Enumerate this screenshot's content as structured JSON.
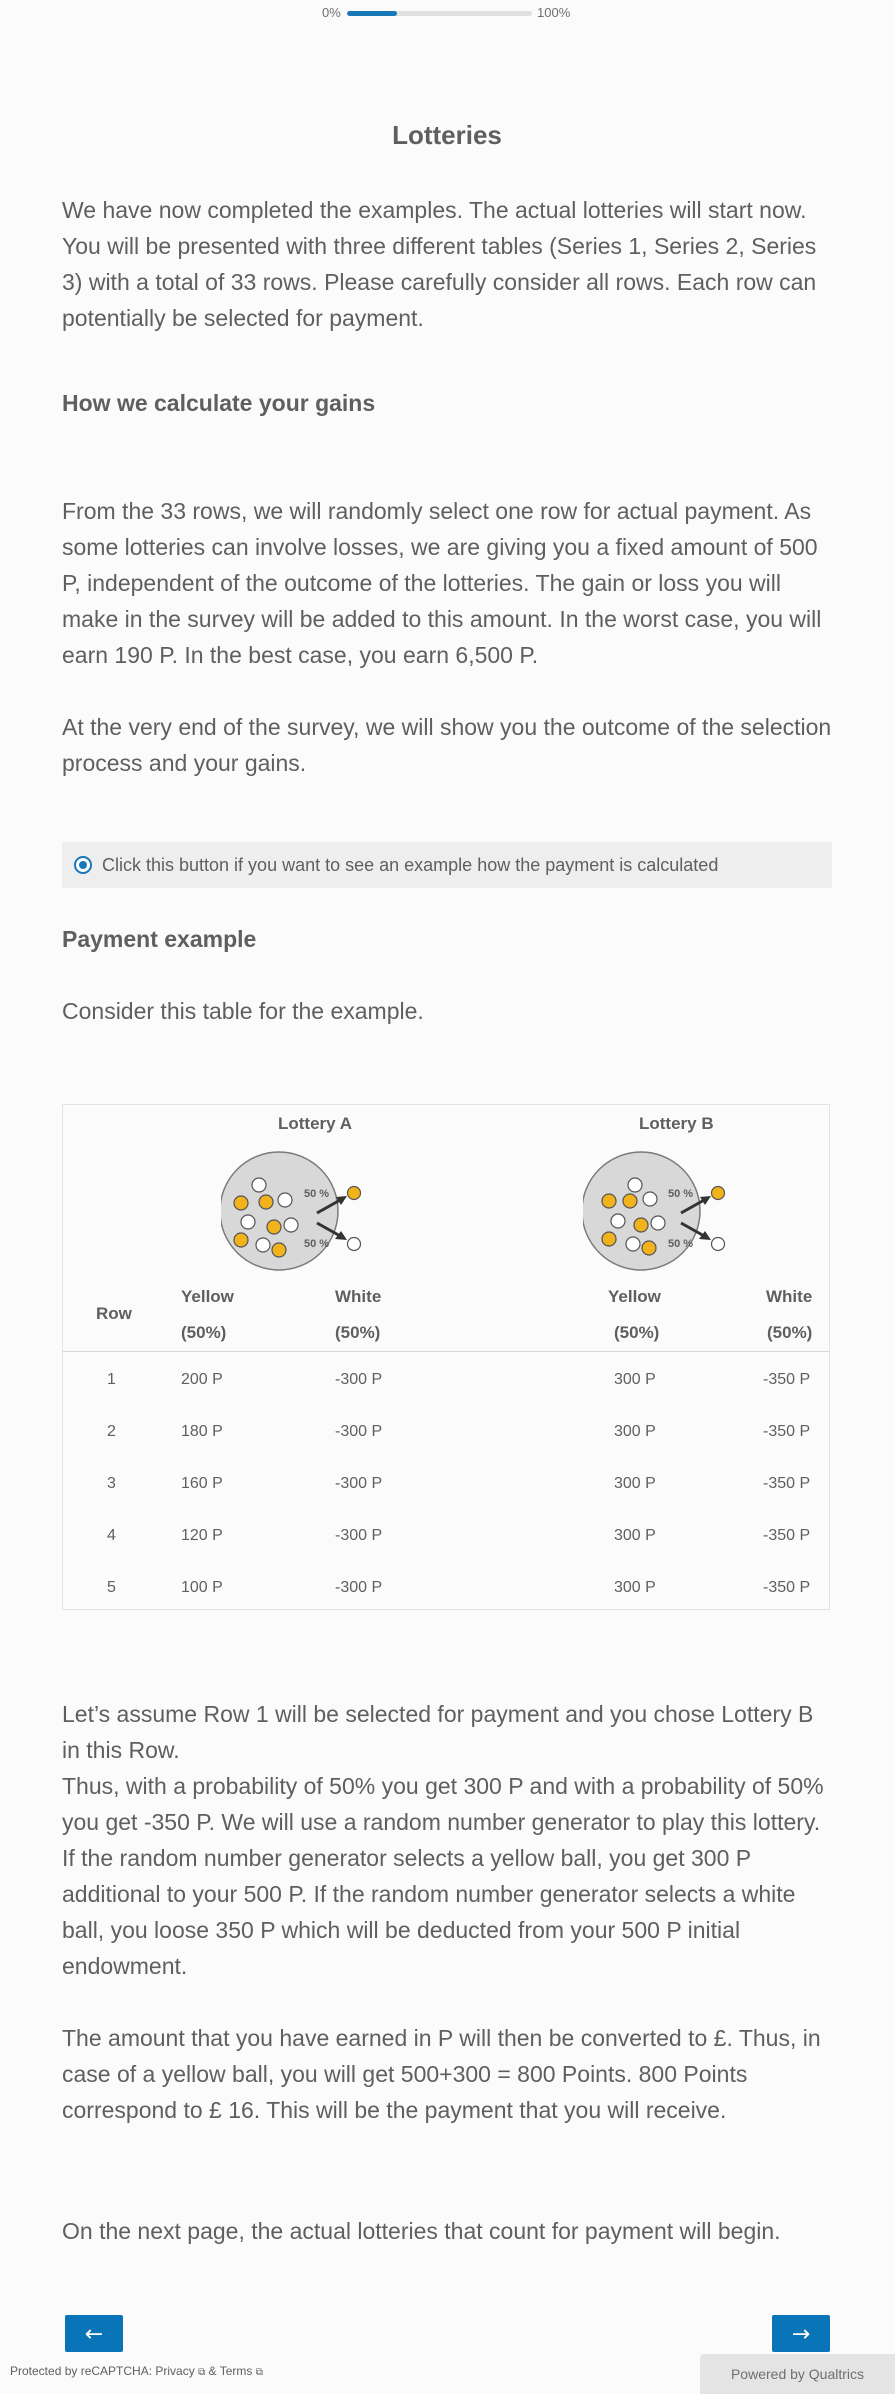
{
  "progress": {
    "left_label": "0%",
    "right_label": "100%",
    "value": 0.27,
    "color": "#1878b8"
  },
  "title": "Lotteries",
  "intro": "We have now completed the examples. The actual lotteries will start now. You will be presented with three different tables (Series 1, Series 2, Series 3) with a total of 33 rows. Please carefully consider all rows. Each row can potentially be selected for payment.",
  "gains_heading": "How we calculate your gains",
  "gains_para1": "From the 33 rows, we will randomly select one row for actual payment. As some lotteries can involve losses, we are giving you a fixed amount of 500 P, independent of the outcome of the lotteries. The gain or loss you will make in the survey will be added to this amount. In the worst case, you will earn 190 P. In the best case, you earn 6,500 P.",
  "gains_para2": "At the very end of the survey, we will show you the outcome of the selection process and your gains.",
  "toggle_label": "Click this button if you want to see an example how the payment is calculated",
  "example_heading": "Payment example",
  "example_intro": "Consider this table for the example.",
  "table": {
    "lottery_a": "Lottery A",
    "lottery_b": "Lottery B",
    "pct_label": "50 %",
    "row_header": "Row",
    "yellow": "Yellow",
    "white": "White",
    "pct_sub": "(50%)",
    "rows": [
      {
        "row": "1",
        "a_yellow": "200 P",
        "a_white": "-300 P",
        "b_yellow": "300 P",
        "b_white": "-350 P"
      },
      {
        "row": "2",
        "a_yellow": "180 P",
        "a_white": "-300 P",
        "b_yellow": "300 P",
        "b_white": "-350 P"
      },
      {
        "row": "3",
        "a_yellow": "160 P",
        "a_white": "-300 P",
        "b_yellow": "300 P",
        "b_white": "-350 P"
      },
      {
        "row": "4",
        "a_yellow": "120 P",
        "a_white": "-300 P",
        "b_yellow": "300 P",
        "b_white": "-350 P"
      },
      {
        "row": "5",
        "a_yellow": "100 P",
        "a_white": "-300 P",
        "b_yellow": "300 P",
        "b_white": "-350 P"
      }
    ],
    "colors": {
      "yellow_ball": "#f2b21b",
      "white_ball": "#ffffff",
      "urn": "#d8d8d8"
    }
  },
  "explain_para1": "Let’s assume Row 1 will be selected for payment and you chose Lottery B in this Row.",
  "explain_para2": "Thus, with a probability of 50% you get 300 P and with a probability of 50% you get -350 P. We will use a random number generator to play this lottery. If the random number generator selects a yellow ball, you get 300 P additional to your 500 P. If the random number generator selects a white ball, you loose 350 P which will be deducted from your 500 P initial endowment.",
  "explain_para3": "The amount that you have earned in P will then be converted to £. Thus, in case of a yellow ball, you will get 500+300 = 800 Points. 800 Points correspond to £ 16. This will be the payment that you will receive.",
  "next_page_note": "On the next page, the actual lotteries that count for payment will begin.",
  "nav": {
    "back": "←",
    "next": "→"
  },
  "footer": {
    "recaptcha_prefix": "Protected by reCAPTCHA: ",
    "privacy": "Privacy",
    "and": " & ",
    "terms": "Terms",
    "powered_by": "Powered by Qualtrics"
  }
}
